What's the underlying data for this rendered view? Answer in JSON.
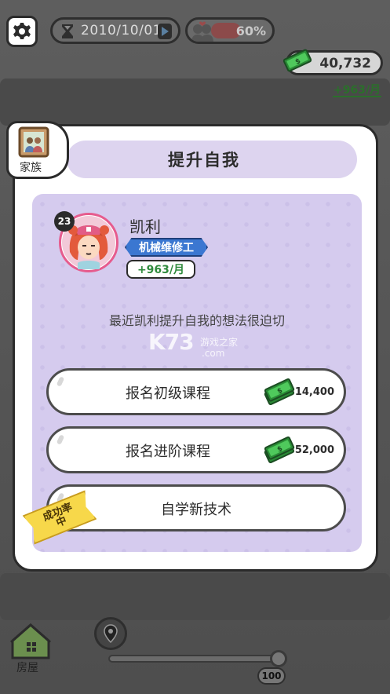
{
  "topbar": {
    "date": "2010/10/01",
    "happiness": "60%",
    "happiness_fraction": 0.6,
    "money": "40,732",
    "income": "+963/月"
  },
  "family_tab": {
    "label": "家族"
  },
  "dialog": {
    "title": "提升自我",
    "character": {
      "level": "23",
      "name": "凯利",
      "job": "机械维修工",
      "salary": "+963/月"
    },
    "description": "最近凯利提升自我的想法很迫切",
    "watermark": {
      "logo": "K73",
      "site": "游戏之家",
      "domain": ".com"
    },
    "options": [
      {
        "label": "报名初级课程",
        "cost": "14,400"
      },
      {
        "label": "报名进阶课程",
        "cost": "52,000"
      },
      {
        "label": "自学新技术",
        "ribbon": "成功率中"
      }
    ]
  },
  "bottom": {
    "house_label": "房屋",
    "slider_value": "100"
  },
  "colors": {
    "accent_purple": "#d5cbee",
    "money_green": "#2e8a3c",
    "job_blue": "#3b77d1",
    "ribbon_yellow": "#f7d84a"
  }
}
